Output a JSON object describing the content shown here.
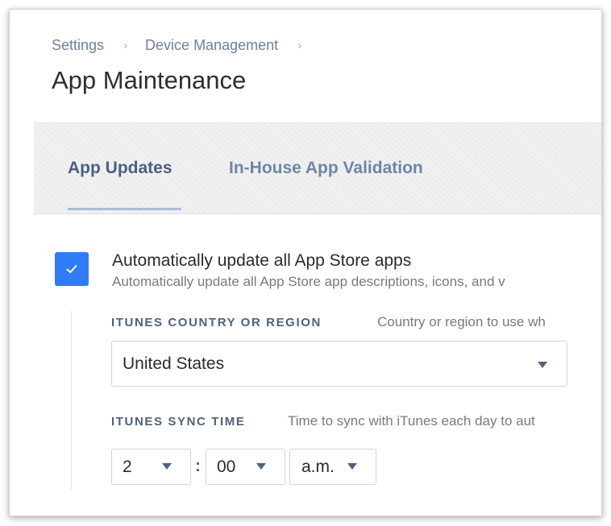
{
  "breadcrumb": {
    "items": [
      "Settings",
      "Device Management"
    ],
    "separator": "›"
  },
  "page": {
    "title": "App Maintenance"
  },
  "tabs": [
    {
      "label": "App Updates",
      "active": true
    },
    {
      "label": "In-House App Validation",
      "active": false
    }
  ],
  "auto_update": {
    "checked": true,
    "label": "Automatically update all App Store apps",
    "description": "Automatically update all App Store app descriptions, icons, and v"
  },
  "country": {
    "label": "ITUNES COUNTRY OR REGION",
    "help": "Country or region to use wh",
    "value": "United States"
  },
  "sync_time": {
    "label": "ITUNES SYNC TIME",
    "help": "Time to sync with iTunes each day to aut",
    "hour": "2",
    "separator": ":",
    "minute": "00",
    "period": "a.m."
  },
  "colors": {
    "accent": "#2f7cf6",
    "tab_active": "#4b5f7f",
    "tab_inactive": "#6f85a5",
    "label": "#4d627f"
  },
  "icons": {
    "checkbox": "checkmark-icon",
    "breadcrumb_separator": "chevron-right-icon",
    "dropdown": "caret-down-icon"
  }
}
